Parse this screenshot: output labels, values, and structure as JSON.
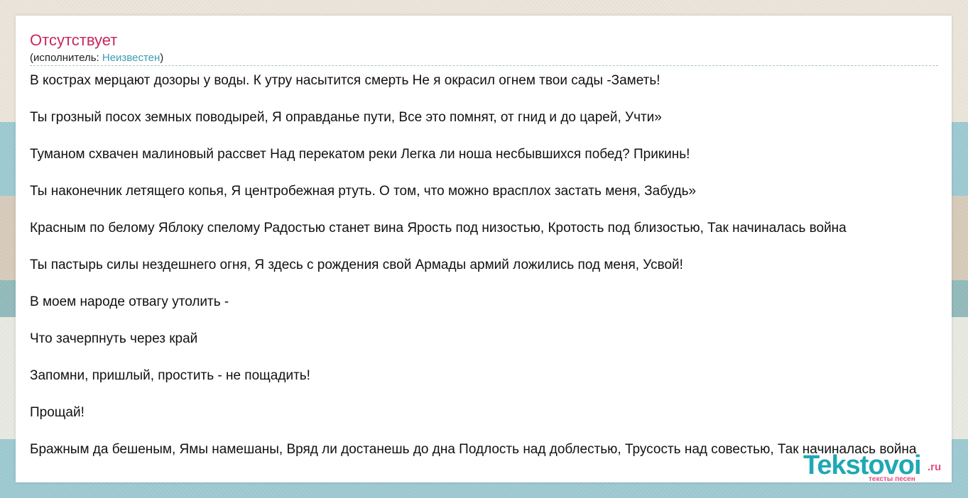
{
  "theme": {
    "title_color": "#c7285f",
    "link_color": "#3a9cb0",
    "brand_teal": "#1fa8b4",
    "brand_pink": "#e4507d",
    "stripe_blue": "#9fcbd3",
    "stripe_tan": "#d8ccbc"
  },
  "song": {
    "title": "Отсутствует",
    "artist_prefix": "(исполнитель: ",
    "artist_name": "Неизвестен",
    "artist_suffix": ")"
  },
  "lyrics": [
    "В кострах мерцают дозоры у воды. К утру насытится смерть Не я окрасил огнем твои сады -Заметь!",
    "Ты грозный посох земных поводырей, Я оправданье пути, Все это помнят, от гнид и до царей, Учти»",
    "Туманом схвачен малиновый рассвет Над перекатом реки Легка ли ноша несбывшихся побед? Прикинь!",
    "Ты наконечник летящего копья, Я центробежная ртуть. О том, что можно врасплох застать меня, Забудь»",
    "Красным по белому Яблоку спелому Радостью станет вина Ярость под низостью, Кротость под близостью, Так начиналась война",
    "Ты пастырь силы нездешнего огня, Я здесь с рождения свой Армады армий ложились под меня, Усвой!",
    "В моем народе отвагу утолить -",
    "Что зачерпнуть через край",
    "Запомни, пришлый, простить - не пощадить!",
    "Прощай!",
    "Бражным да бешеным, Ямы намешаны, Вряд ли достанешь до дна Подлость над доблестью, Трусость над совестью, Так начиналась война"
  ],
  "watermark": {
    "brand": "Tekstovoi",
    "domain": ".ru",
    "tagline": "тексты песен"
  }
}
